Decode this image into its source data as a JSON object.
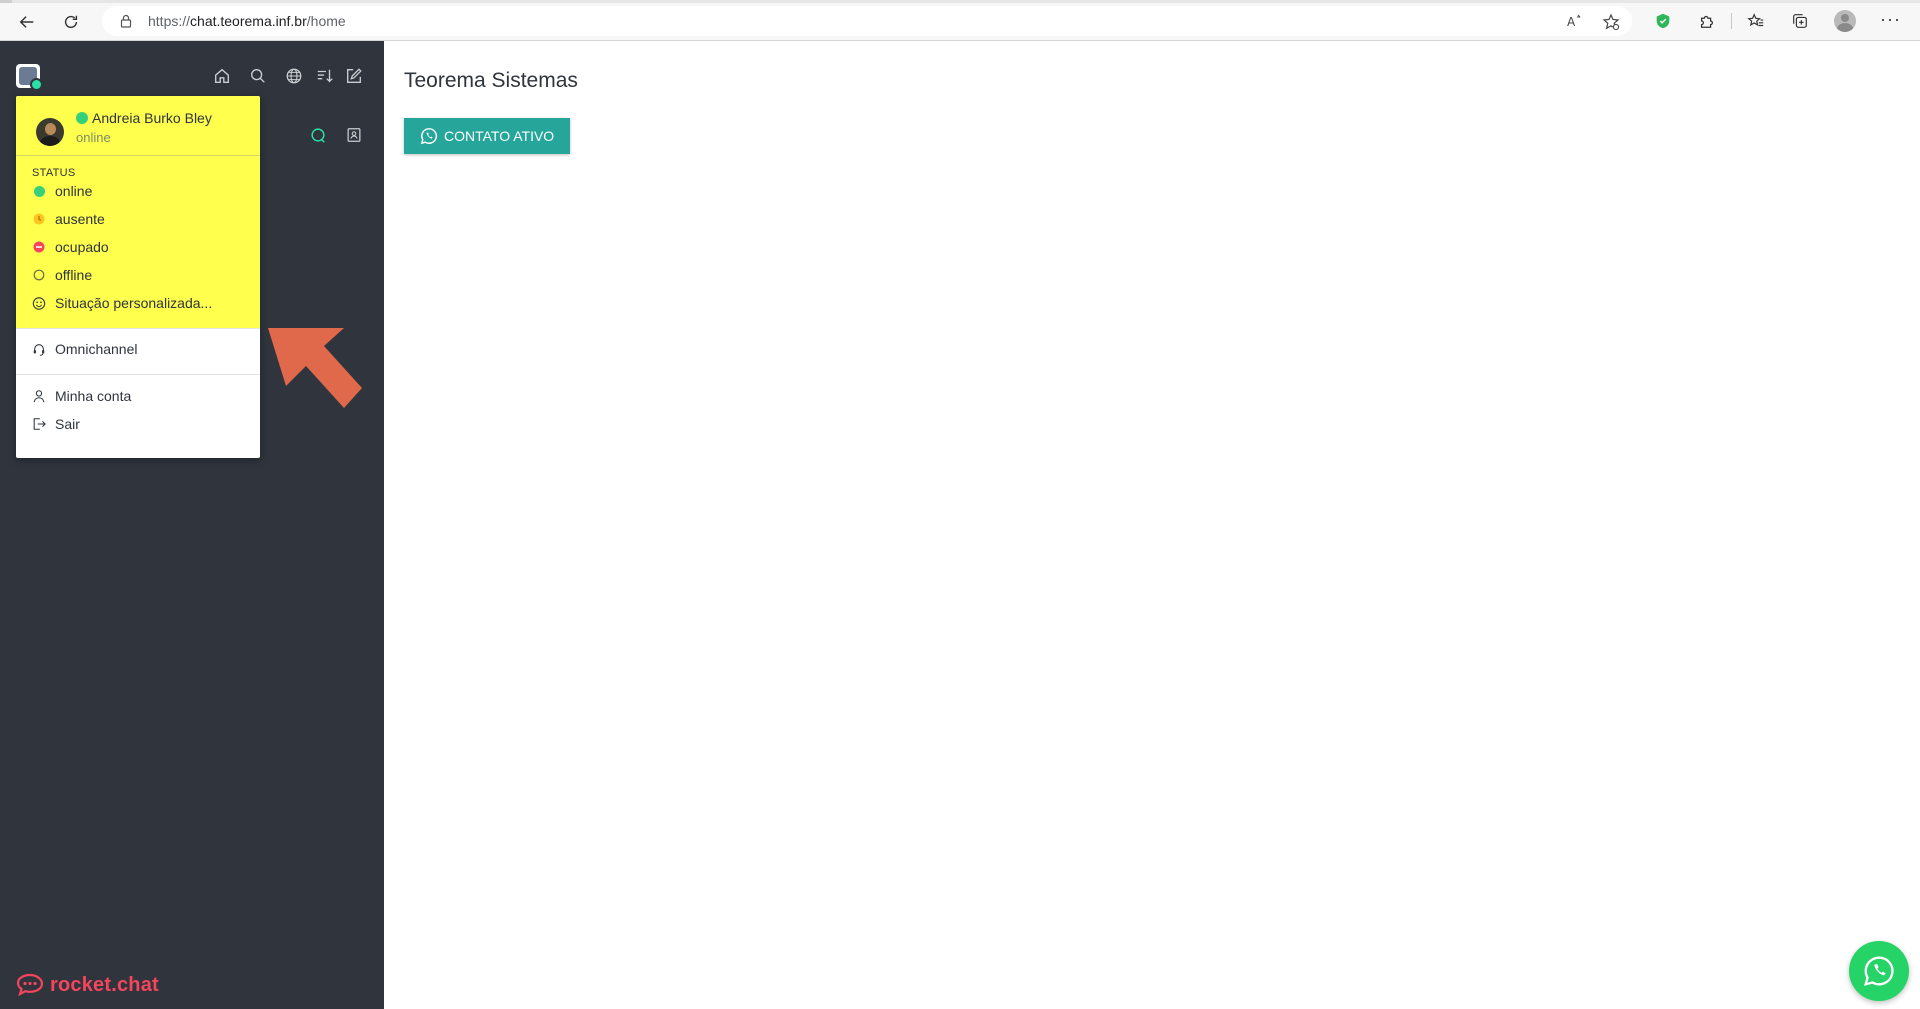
{
  "browser": {
    "url_scheme": "https://",
    "url_host": "chat.teorema.inf.br",
    "url_path": "/home"
  },
  "sidebar": {
    "header_icons": [
      "home-icon",
      "search-icon",
      "directory-icon",
      "sort-icon",
      "create-new-icon"
    ],
    "sub_icons": [
      "omnichannel-icon",
      "contact-center-icon"
    ],
    "logo_text": "rocket.chat"
  },
  "user_menu": {
    "user_name": "Andreia Burko Bley",
    "user_status": "online",
    "status_section_label": "STATUS",
    "status_options": [
      {
        "label": "online",
        "color": "#2de0a5"
      },
      {
        "label": "ausente",
        "color": "#ffd21f"
      },
      {
        "label": "ocupado",
        "color": "#f5455c"
      },
      {
        "label": "offline",
        "color": "#cbced1"
      }
    ],
    "custom_status_label": "Situação personalizada...",
    "omnichannel_label": "Omnichannel",
    "account_label": "Minha conta",
    "logout_label": "Sair",
    "highlight_color": "#ffff4d"
  },
  "annotation": {
    "arrow_color": "#e0684b"
  },
  "main": {
    "title": "Teorema Sistemas",
    "contact_button_label": "CONTATO ATIVO",
    "button_color": "#26a69a",
    "whatsapp_fab_color": "#25d366"
  }
}
